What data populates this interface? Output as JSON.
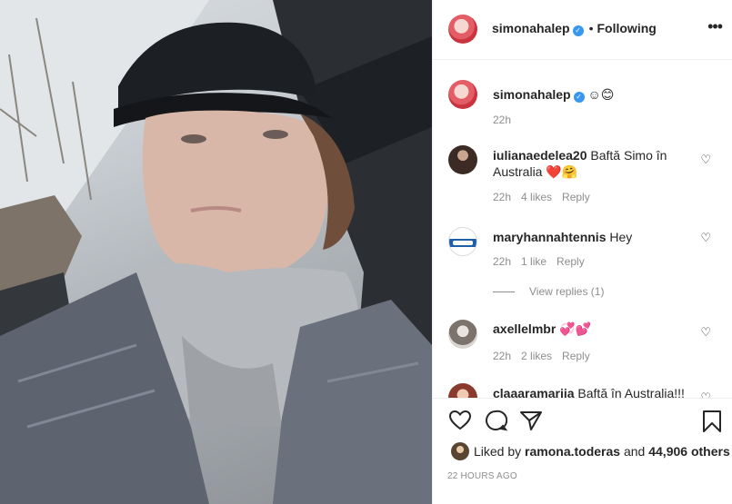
{
  "post_header": {
    "username": "simonahalep",
    "separator": "•",
    "follow_status": "Following",
    "more_icon": "more-options-icon"
  },
  "caption": {
    "username": "simonahalep",
    "text": "☺😊",
    "time": "22h"
  },
  "comments": [
    {
      "username": "iulianaedelea20",
      "text": "Baftă Simo în Australia ❤️🤗",
      "time": "22h",
      "likes": "4 likes",
      "reply": "Reply"
    },
    {
      "username": "maryhannahtennis",
      "text": "Hey",
      "time": "22h",
      "likes": "1 like",
      "reply": "Reply",
      "view_replies": "View replies (1)"
    },
    {
      "username": "axellelmbr",
      "text": "💞💕",
      "time": "22h",
      "likes": "2 likes",
      "reply": "Reply"
    },
    {
      "username": "claaaramariia",
      "text": "Baftă în Australia!!!"
    }
  ],
  "actions": {
    "icons": [
      "heart-icon",
      "comment-icon",
      "share-icon",
      "bookmark-icon"
    ]
  },
  "likes": {
    "prefix": "Liked by",
    "liker": "ramona.toderas",
    "and": "and",
    "others": "44,906 others"
  },
  "timestamp": "22 HOURS AGO",
  "colors": {
    "verified_blue": "#3897f0",
    "meta_gray": "#8e8e8e",
    "text": "#262626"
  }
}
